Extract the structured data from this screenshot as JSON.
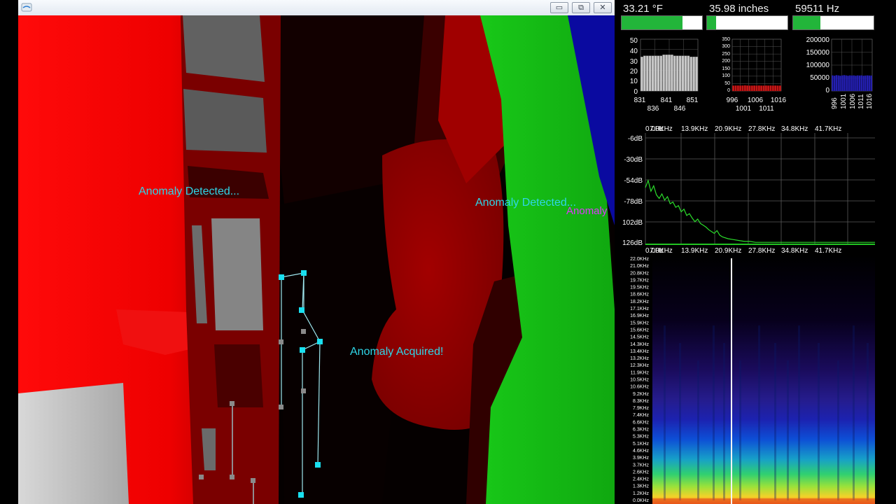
{
  "overlays": {
    "detected_1": "Anomaly Detected...",
    "detected_2": "Anomaly Detected...",
    "acquired": "Anomaly Acquired!",
    "tag": "Anomaly"
  },
  "window": {
    "controls": {
      "minimize": "▭",
      "restore": "⧉",
      "close": "✕"
    }
  },
  "gauges": [
    {
      "label": "33.21 °F",
      "level": 0.76
    },
    {
      "label": "35.98 inches",
      "level": 0.11
    },
    {
      "label": "59511 Hz",
      "level": 0.34
    }
  ],
  "charts": {
    "temp": {
      "y_ticks": [
        "50",
        "40",
        "30",
        "20",
        "10",
        "0"
      ],
      "x_ticks_top": [
        "831",
        "841",
        "851"
      ],
      "x_ticks_bottom": [
        "836",
        "846"
      ]
    },
    "distance": {
      "y_ticks": [
        "350",
        "300",
        "250",
        "200",
        "150",
        "100",
        "50",
        "0"
      ],
      "x_ticks_top": [
        "996",
        "1006",
        "1016"
      ],
      "x_ticks_bottom": [
        "1001",
        "1011"
      ]
    },
    "frequency": {
      "y_ticks": [
        "200000",
        "150000",
        "100000",
        "50000",
        "0"
      ],
      "x_ticks": [
        "996",
        "1001",
        "1006",
        "1011",
        "1016"
      ]
    }
  },
  "spectrum": {
    "x_ticks": [
      "0.0Hz",
      "7.0KHz",
      "13.9KHz",
      "20.9KHz",
      "27.8KHz",
      "34.8KHz",
      "41.7KHz"
    ],
    "y_ticks": [
      "-6dB",
      "-30dB",
      "-54dB",
      "-78dB",
      "102dB",
      "126dB"
    ]
  },
  "spectrogram": {
    "freq_labels": [
      "22.0KHz",
      "21.0KHz",
      "20.8KHz",
      "19.7KHz",
      "19.5KHz",
      "18.6KHz",
      "18.2KHz",
      "17.1KHz",
      "16.9KHz",
      "15.9KHz",
      "15.6KHz",
      "14.5KHz",
      "14.3KHz",
      "13.4KHz",
      "13.2KHz",
      "12.3KHz",
      "11.9KHz",
      "10.5KHz",
      "10.6KHz",
      "9.2KHz",
      "8.3KHz",
      "7.9KHz",
      "7.4KHz",
      "6.6KHz",
      "6.3KHz",
      "5.3KHz",
      "5.1KHz",
      "4.6KHz",
      "3.9KHz",
      "3.7KHz",
      "2.6KHz",
      "2.4KHz",
      "1.3KHz",
      "1.2KHz",
      "0.0KHz"
    ]
  },
  "chart_data": [
    {
      "type": "bar",
      "x": [
        831,
        832,
        833,
        834,
        835,
        836,
        837,
        838,
        839,
        840,
        841,
        842,
        843,
        844,
        845,
        846,
        847,
        848,
        849,
        850,
        851
      ],
      "values": [
        33,
        34,
        34,
        34,
        34,
        34,
        34,
        34,
        35,
        35,
        35,
        35,
        34,
        34,
        34,
        34,
        34,
        34,
        33,
        33,
        33
      ],
      "ylim": [
        0,
        50
      ]
    },
    {
      "type": "bar",
      "x": [
        996,
        997,
        998,
        999,
        1000,
        1001,
        1002,
        1003,
        1004,
        1005,
        1006,
        1007,
        1008,
        1009,
        1010,
        1011,
        1012,
        1013,
        1014,
        1015,
        1016
      ],
      "values": [
        36,
        37,
        37,
        36,
        37,
        38,
        37,
        36,
        36,
        37,
        36,
        37,
        36,
        36,
        37,
        36,
        37,
        36,
        37,
        36,
        36
      ],
      "ylim": [
        0,
        350
      ]
    },
    {
      "type": "bar",
      "x": [
        996,
        997,
        998,
        999,
        1000,
        1001,
        1002,
        1003,
        1004,
        1005,
        1006,
        1007,
        1008,
        1009,
        1010,
        1011,
        1012,
        1013,
        1014,
        1015,
        1016
      ],
      "values": [
        60000,
        59000,
        61000,
        60000,
        59000,
        60000,
        61000,
        60000,
        59000,
        60000,
        59500,
        60000,
        59000,
        60000,
        59500,
        60000,
        59000,
        59500,
        60000,
        59500,
        59511
      ],
      "ylim": [
        0,
        200000
      ]
    },
    {
      "type": "line",
      "x_khz": [
        0,
        0.5,
        1,
        1.5,
        2,
        2.5,
        3,
        3.5,
        4,
        4.5,
        5,
        5.5,
        6,
        6.5,
        7,
        7.5,
        8,
        8.5,
        9,
        9.5,
        10,
        10.5,
        11,
        11.5,
        12,
        12.5,
        13,
        13.5,
        14,
        15,
        16,
        17,
        18,
        19,
        20,
        22,
        25,
        30,
        35,
        41.7
      ],
      "y_db": [
        -66,
        -58,
        -70,
        -64,
        -74,
        -78,
        -73,
        -80,
        -76,
        -84,
        -82,
        -88,
        -86,
        -93,
        -90,
        -97,
        -95,
        -100,
        -104,
        -101,
        -106,
        -108,
        -110,
        -113,
        -115,
        -117,
        -114,
        -119,
        -121,
        -123,
        -124,
        -125,
        -126,
        -126,
        -127,
        -127,
        -127,
        -127,
        -127,
        -127
      ],
      "ylim": [
        -130,
        -5
      ]
    }
  ]
}
